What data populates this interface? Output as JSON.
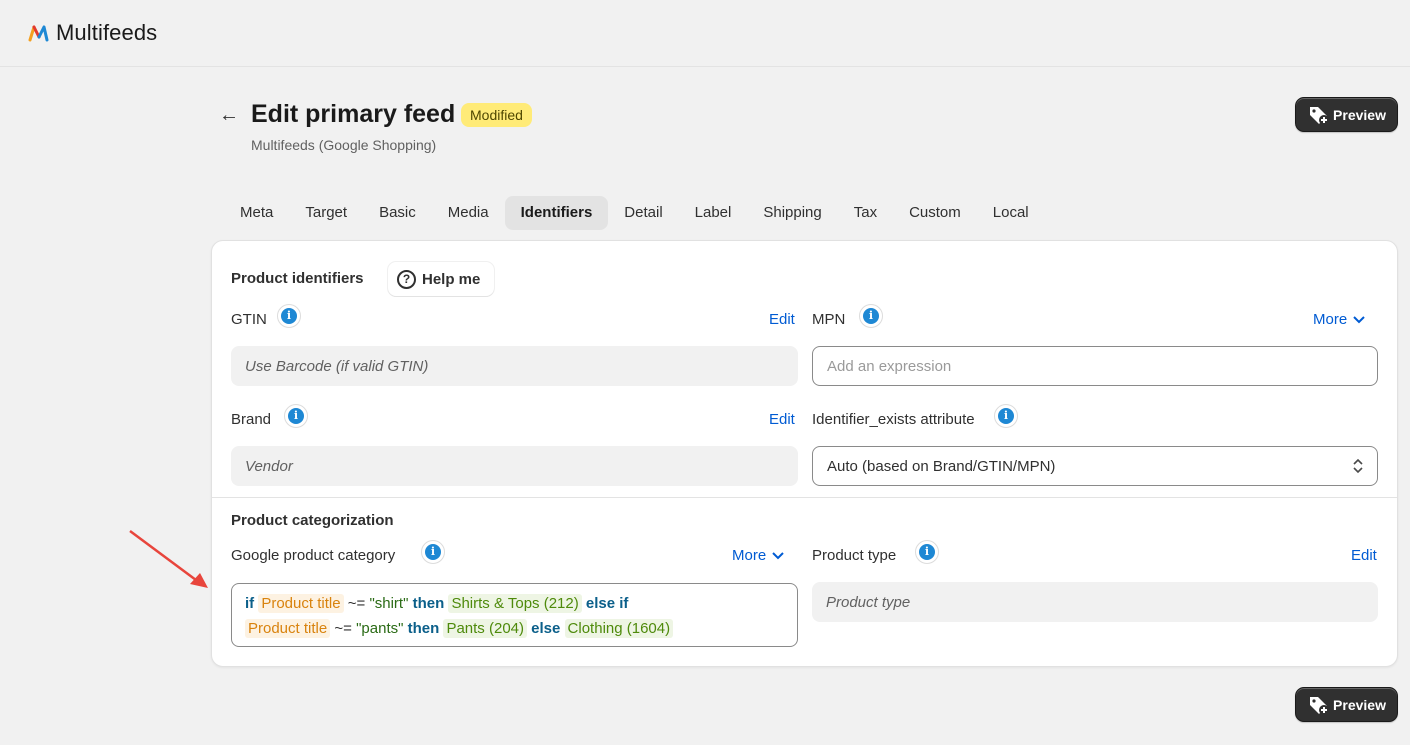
{
  "app": {
    "name": "Multifeeds",
    "logo_icon": "multifeeds-logo-icon",
    "brand_colors": [
      "#f4a020",
      "#e23a2f",
      "#1e88d4"
    ]
  },
  "header": {
    "back_icon": "arrow-left-icon",
    "title": "Edit primary feed",
    "badge": "Modified",
    "subtitle": "Multifeeds (Google Shopping)",
    "preview_label": "Preview",
    "preview_icon": "tag-plus-icon"
  },
  "tabs": [
    {
      "label": "Meta"
    },
    {
      "label": "Target"
    },
    {
      "label": "Basic"
    },
    {
      "label": "Media"
    },
    {
      "label": "Identifiers",
      "active": true
    },
    {
      "label": "Detail"
    },
    {
      "label": "Label"
    },
    {
      "label": "Shipping"
    },
    {
      "label": "Tax"
    },
    {
      "label": "Custom"
    },
    {
      "label": "Local"
    }
  ],
  "identifiers": {
    "section_title": "Product identifiers",
    "help_label": "Help me",
    "gtin": {
      "label": "GTIN",
      "action": "Edit",
      "value": "Use Barcode (if valid GTIN)"
    },
    "mpn": {
      "label": "MPN",
      "action": "More",
      "placeholder": "Add an expression"
    },
    "brand": {
      "label": "Brand",
      "action": "Edit",
      "value": "Vendor"
    },
    "identifier_exists": {
      "label": "Identifier_exists attribute",
      "value": "Auto (based on Brand/GTIN/MPN)"
    }
  },
  "categorization": {
    "section_title": "Product categorization",
    "google_category": {
      "label": "Google product category",
      "action": "More",
      "expression": {
        "if1": "if",
        "attr1": "Product title",
        "op1": "~=",
        "str1": "\"shirt\"",
        "then1": "then",
        "cat1": "Shirts & Tops (212)",
        "elseif": "else if",
        "attr2": "Product title",
        "op2": "~=",
        "str2": "\"pants\"",
        "then2": "then",
        "cat2": "Pants (204)",
        "else": "else",
        "cat3": "Clothing (1604)"
      }
    },
    "product_type": {
      "label": "Product type",
      "action": "Edit",
      "value": "Product type"
    }
  },
  "annotation": {
    "arrow_color": "#e8453c"
  },
  "footer": {
    "preview_label": "Preview"
  }
}
